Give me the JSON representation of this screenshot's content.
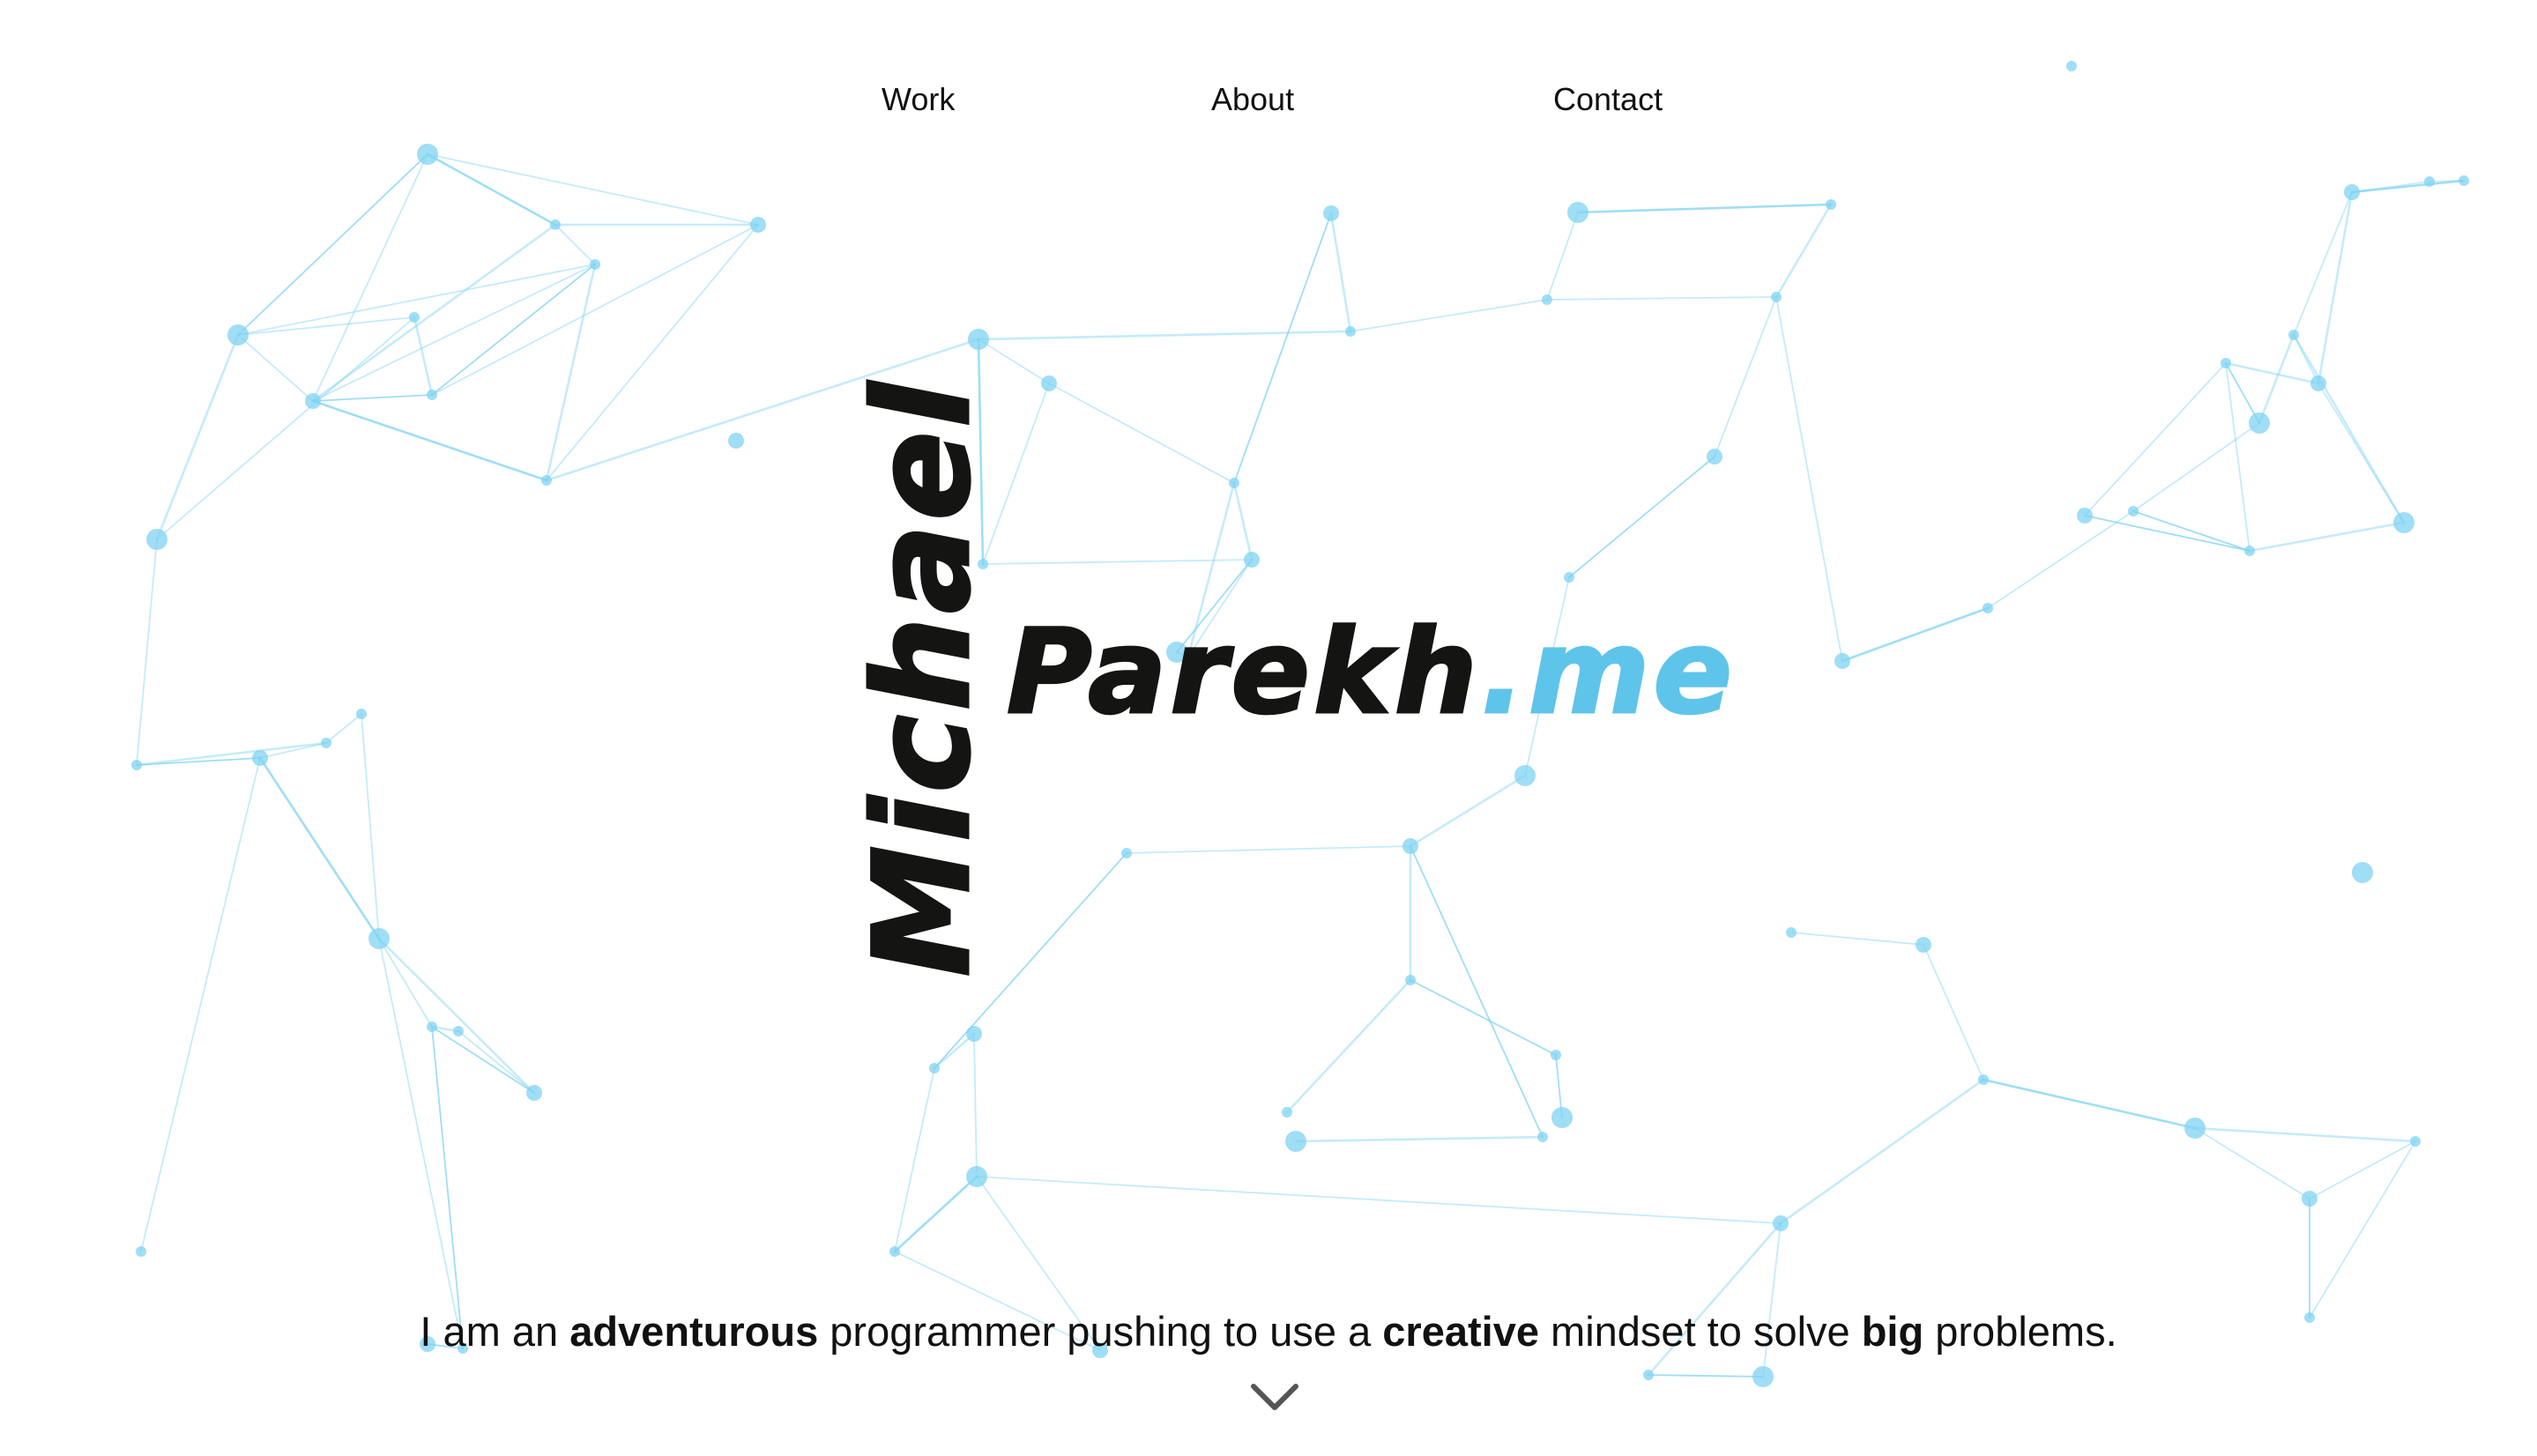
{
  "nav": {
    "items": [
      {
        "label": "Work"
      },
      {
        "label": "About"
      },
      {
        "label": "Contact"
      }
    ]
  },
  "logo": {
    "first_name": "Michael",
    "last_name": "Parekh",
    "domain_ext": ".me"
  },
  "tagline": {
    "part1": "I am an ",
    "emph1": "adventurous",
    "part2": " programmer pushing to use a ",
    "emph2": "creative",
    "part3": " mindset to solve ",
    "emph3": "big",
    "part4": " problems."
  },
  "scroll": {
    "icon": "chevron-down-icon"
  },
  "colors": {
    "accent": "#5fc4ea",
    "network": "#7fd3f2",
    "text": "#111111",
    "background": "#ffffff"
  }
}
